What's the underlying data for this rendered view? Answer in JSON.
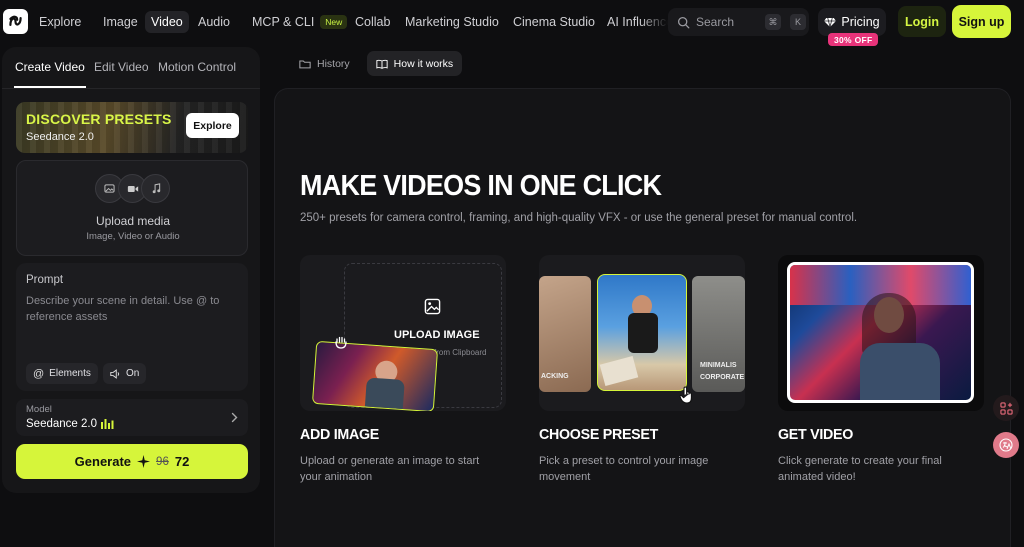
{
  "nav": {
    "items": [
      {
        "label": "Explore",
        "active": false
      },
      {
        "label": "Image",
        "active": false
      },
      {
        "label": "Video",
        "active": true
      },
      {
        "label": "Audio",
        "active": false
      },
      {
        "label": "MCP & CLI",
        "active": false,
        "badge": "New"
      },
      {
        "label": "Collab",
        "active": false
      },
      {
        "label": "Marketing Studio",
        "active": false
      },
      {
        "label": "Cinema Studio",
        "active": false
      },
      {
        "label": "AI Influence",
        "active": false
      }
    ],
    "search_placeholder": "Search",
    "search_shortcut_keys": [
      "⌘",
      "K"
    ],
    "pricing_label": "Pricing",
    "pricing_promo": "30% OFF",
    "login_label": "Login",
    "signup_label": "Sign up",
    "accent_color": "#d6f53a",
    "promo_color": "#e8337a"
  },
  "left_panel": {
    "tabs": [
      {
        "label": "Create Video",
        "active": true
      },
      {
        "label": "Edit Video",
        "active": false
      },
      {
        "label": "Motion Control",
        "active": false
      }
    ],
    "preset_banner": {
      "title": "DISCOVER PRESETS",
      "subtitle": "Seedance 2.0",
      "button_label": "Explore"
    },
    "upload": {
      "icons": [
        "image-icon",
        "video-icon",
        "music-icon"
      ],
      "title": "Upload media",
      "subtitle": "Image, Video or Audio"
    },
    "prompt": {
      "label": "Prompt",
      "placeholder": "Describe your scene in detail. Use @ to reference assets",
      "chips": [
        {
          "icon": "at-icon",
          "label": "Elements"
        },
        {
          "icon": "speaker-icon",
          "label": "On"
        }
      ]
    },
    "model": {
      "label": "Model",
      "name": "Seedance 2.0"
    },
    "generate": {
      "label": "Generate",
      "old_cost": "96",
      "cost": "72"
    }
  },
  "content": {
    "tabs": [
      {
        "icon": "folder-icon",
        "label": "History",
        "active": false
      },
      {
        "icon": "book-icon",
        "label": "How it works",
        "active": true
      }
    ],
    "hero_title": "MAKE VIDEOS IN ONE CLICK",
    "hero_subtitle": "250+ presets for camera control, framing, and high-quality VFX - or use the general preset for manual control.",
    "cards": [
      {
        "title": "ADD IMAGE",
        "description": "Upload or generate an image to start your animation",
        "upload_label": "UPLOAD IMAGE",
        "clipboard_hint": "from Clipboard"
      },
      {
        "title": "CHOOSE PRESET",
        "description": "Pick a preset to control your image movement",
        "preset_labels": [
          "ACKING",
          "MINIMALIS",
          "CORPORATE"
        ]
      },
      {
        "title": "GET VIDEO",
        "description": "Click generate to create your final animated video!"
      }
    ]
  }
}
